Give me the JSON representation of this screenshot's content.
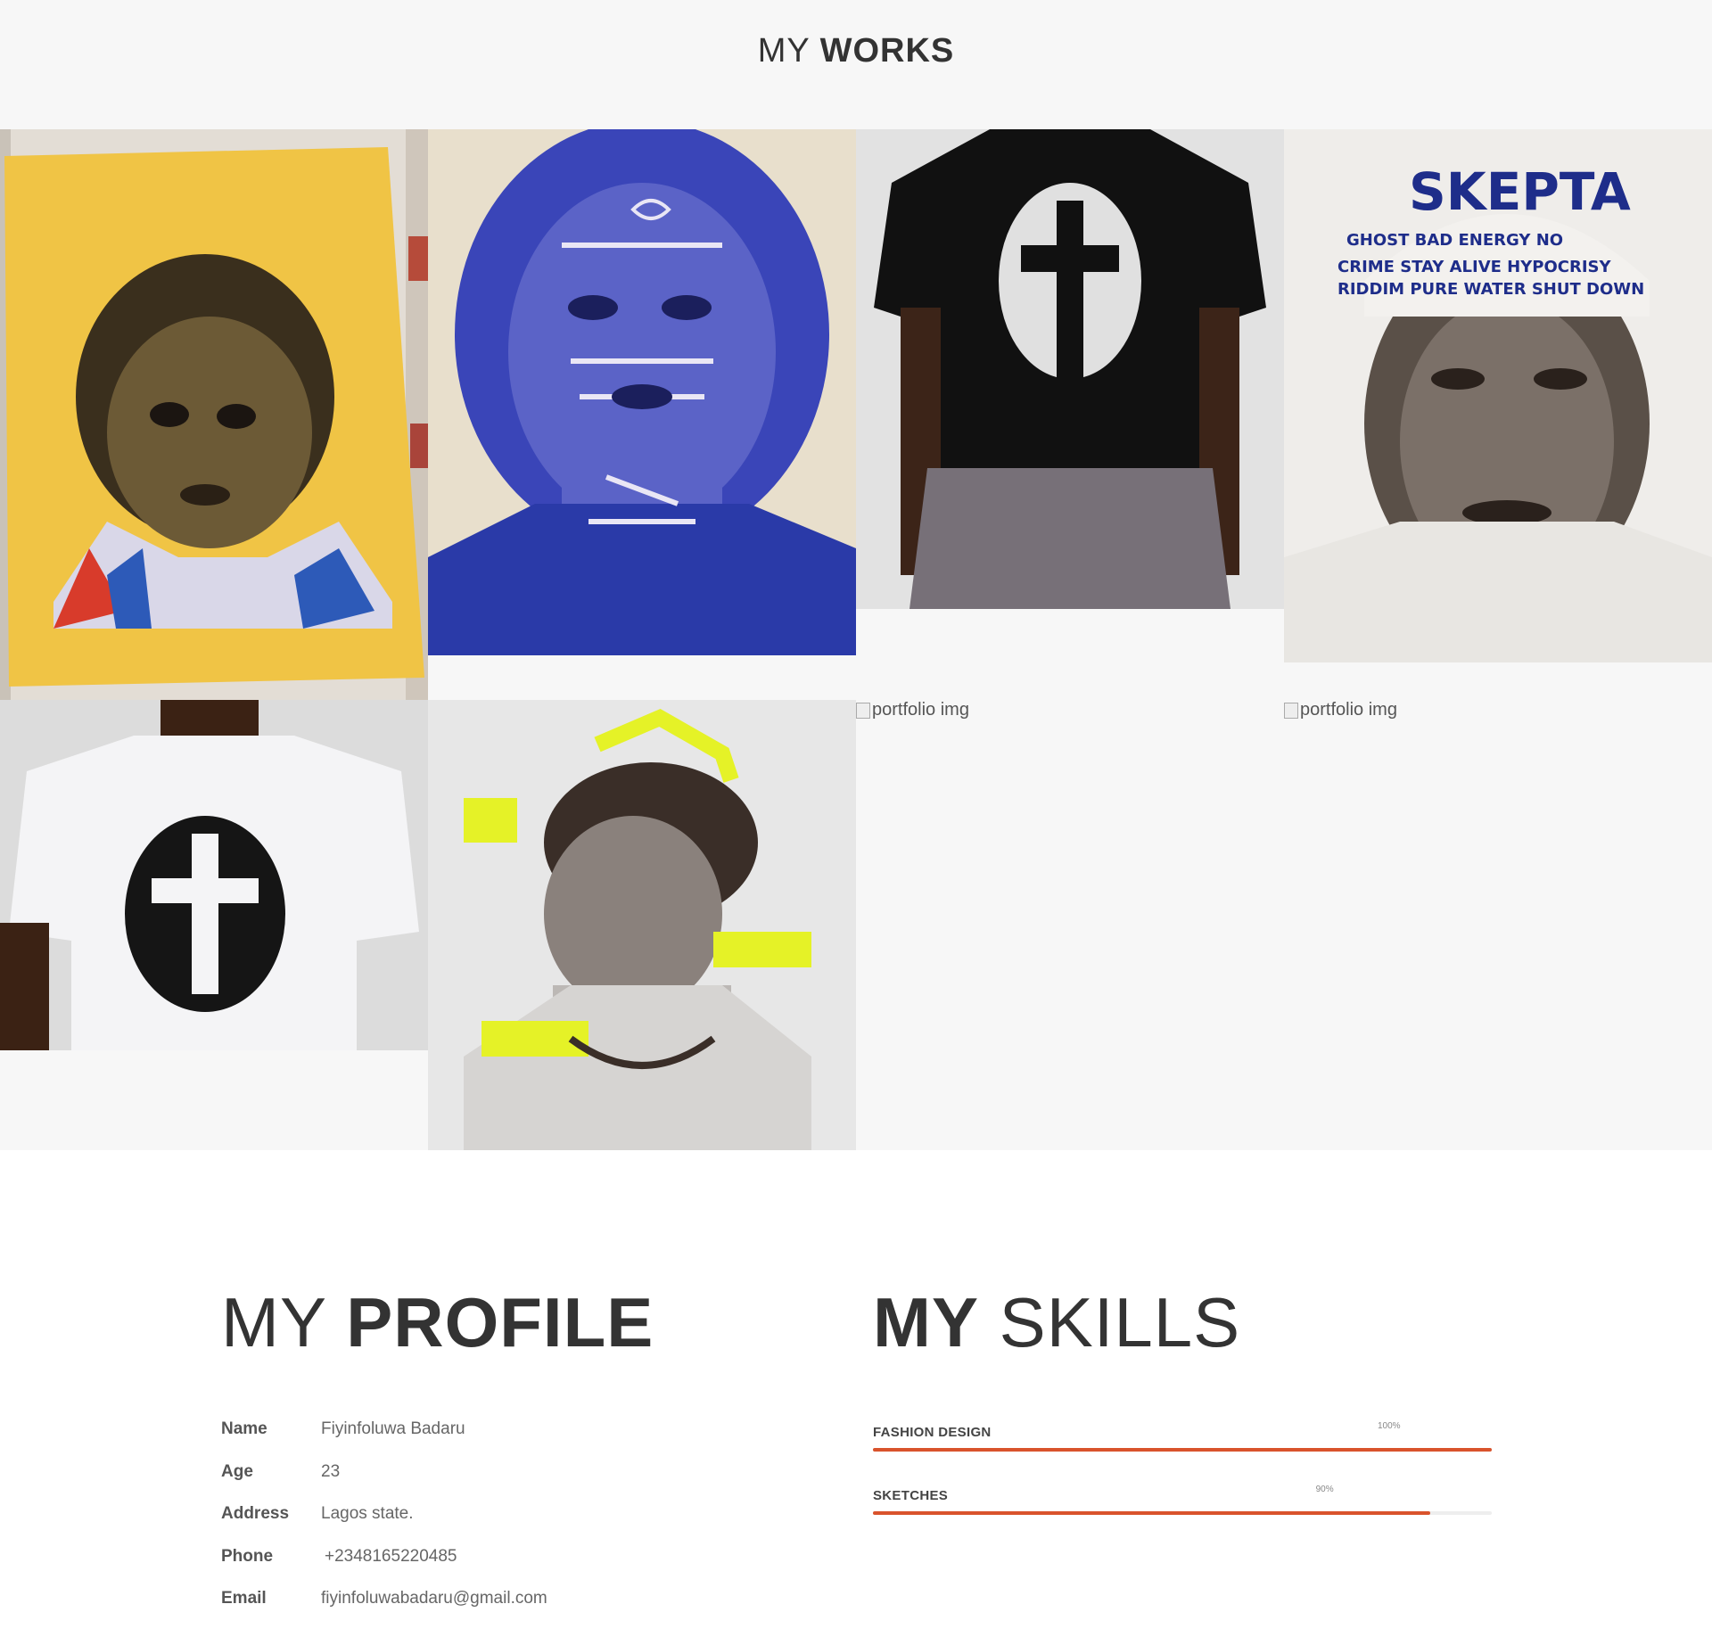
{
  "works": {
    "title_light": "MY",
    "title_bold": "WORKS",
    "items": [
      {
        "alt": "portfolio img",
        "loaded": true
      },
      {
        "alt": "portfolio img",
        "loaded": true
      },
      {
        "alt": "portfolio img",
        "loaded": true
      },
      {
        "alt": "portfolio img",
        "loaded": true
      },
      {
        "alt": "portfolio img",
        "loaded": true
      },
      {
        "alt": "portfolio img",
        "loaded": true
      },
      {
        "alt": "portfolio img",
        "loaded": false
      },
      {
        "alt": "portfolio img",
        "loaded": false
      }
    ]
  },
  "profile": {
    "title_light": "MY",
    "title_bold": "PROFILE",
    "rows": [
      {
        "label": "Name",
        "value": "Fiyinfoluwa Badaru"
      },
      {
        "label": "Age",
        "value": "23"
      },
      {
        "label": "Address",
        "value": "Lagos state."
      },
      {
        "label": "Phone",
        "value": "+2348165220485"
      },
      {
        "label": "Email",
        "value": "fiyinfoluwabadaru@gmail.com"
      }
    ]
  },
  "skills": {
    "title_bold": "MY",
    "title_light": "SKILLS",
    "items": [
      {
        "name": "FASHION DESIGN",
        "percent_label": "100%",
        "value": 1.0
      },
      {
        "name": "SKETCHES",
        "percent_label": "90%",
        "value": 0.9
      }
    ],
    "accent_color": "#d9532c"
  }
}
